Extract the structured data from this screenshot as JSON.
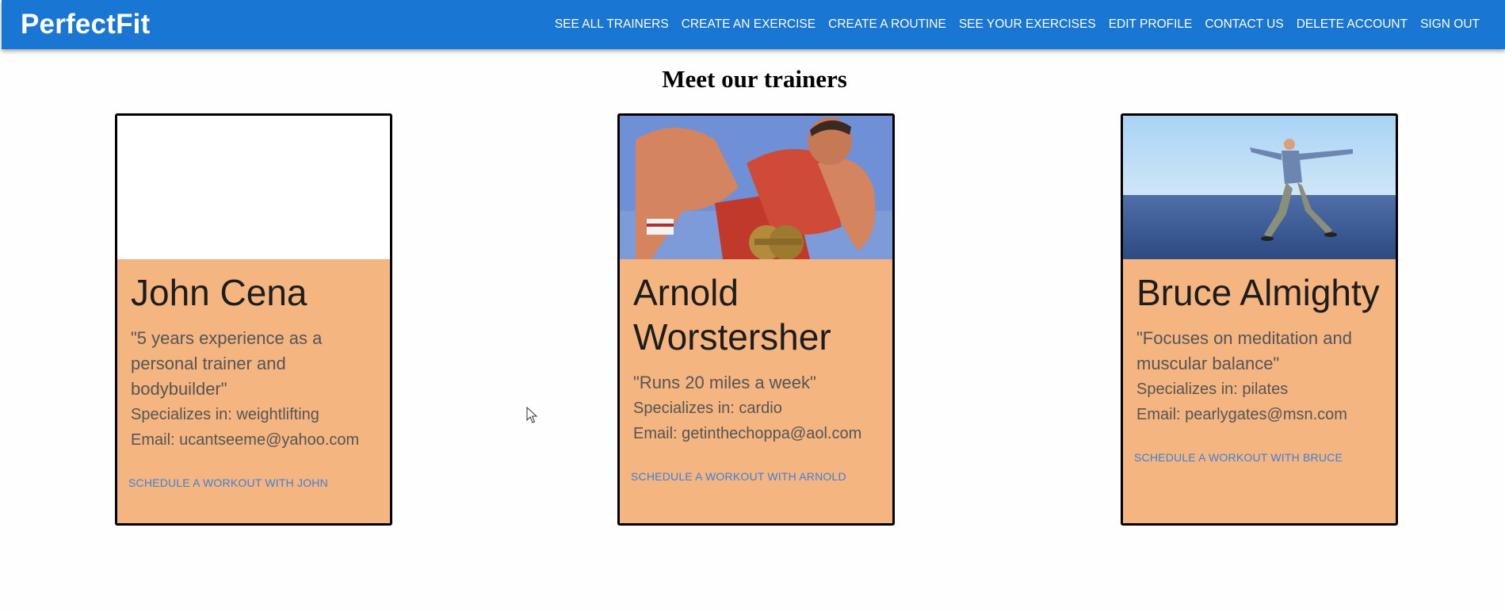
{
  "app": {
    "brand": "PerfectFit",
    "accent_color": "#1976d2",
    "card_color": "#f5b580"
  },
  "nav": {
    "items": [
      {
        "label": "SEE ALL TRAINERS"
      },
      {
        "label": "CREATE AN EXERCISE"
      },
      {
        "label": "CREATE A ROUTINE"
      },
      {
        "label": "SEE YOUR EXERCISES"
      },
      {
        "label": "EDIT PROFILE"
      },
      {
        "label": "CONTACT US"
      },
      {
        "label": "DELETE ACCOUNT"
      },
      {
        "label": "SIGN OUT"
      }
    ]
  },
  "page": {
    "title": "Meet our trainers"
  },
  "trainers": [
    {
      "name": "John Cena",
      "quote": "\"5 years experience as a personal trainer and bodybuilder\"",
      "specialty": "Specializes in: weightlifting",
      "email": "Email: ucantseeme@yahoo.com",
      "action": "SCHEDULE A WORKOUT WITH JOHN",
      "image": "blank-photo"
    },
    {
      "name": "Arnold Worstersher",
      "quote": "\"Runs 20 miles a week\"",
      "specialty": "Specializes in: cardio",
      "email": "Email: getinthechoppa@aol.com",
      "action": "SCHEDULE A WORKOUT WITH ARNOLD",
      "image": "bodybuilder-photo"
    },
    {
      "name": "Bruce Almighty",
      "quote": "\"Focuses on meditation and muscular balance\"",
      "specialty": "Specializes in: pilates",
      "email": "Email: pearlygates@msn.com",
      "action": "SCHEDULE A WORKOUT WITH BRUCE",
      "image": "walking-on-water-photo"
    }
  ]
}
